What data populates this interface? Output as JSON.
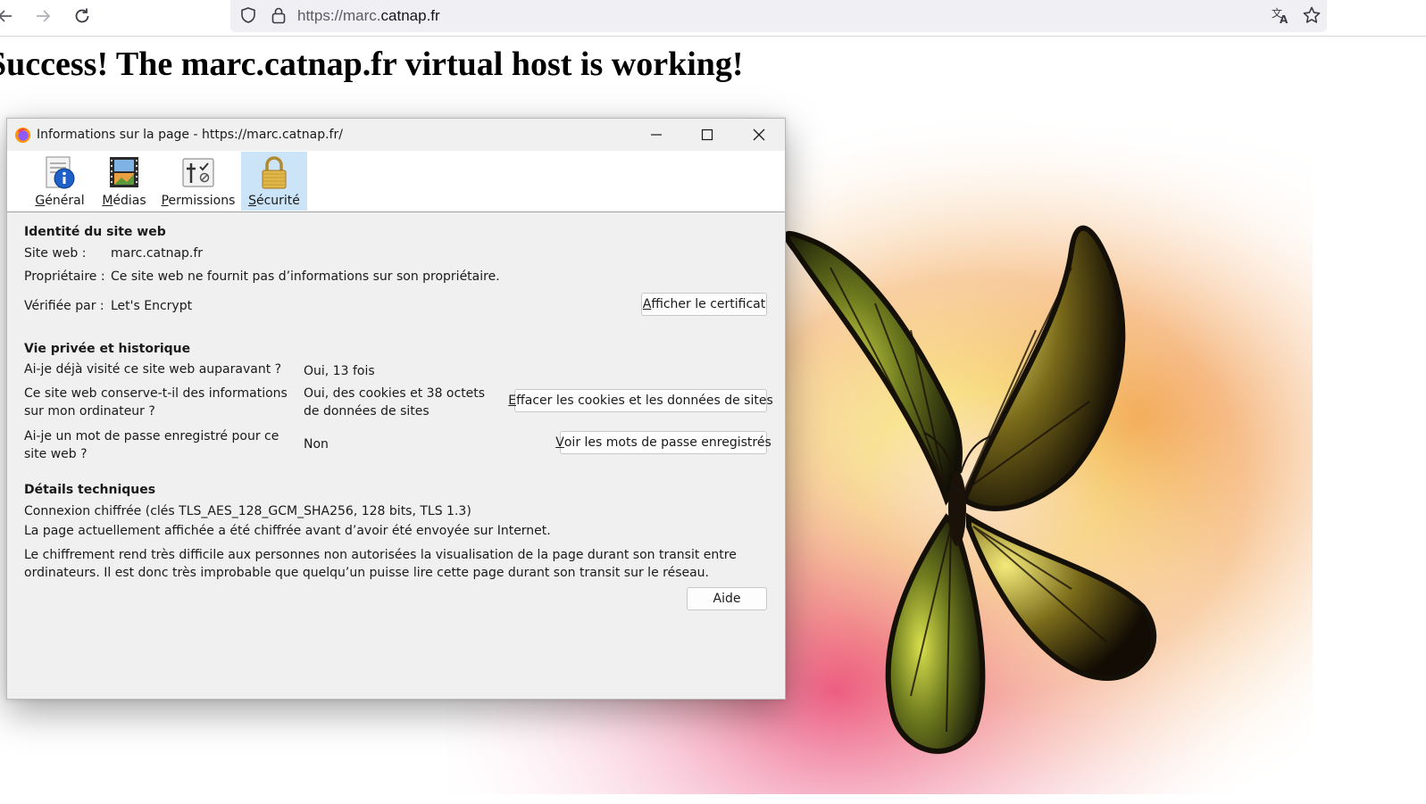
{
  "browser": {
    "url_prefix": "https://marc.",
    "url_domain": "catnap.fr"
  },
  "page": {
    "heading": "Success! The marc.catnap.fr virtual host is working!"
  },
  "dialog": {
    "title": "Informations sur la page - https://marc.catnap.fr/",
    "tabs": [
      {
        "underline": "G",
        "rest": "énéral",
        "icon": "info-icon"
      },
      {
        "underline": "M",
        "rest": "édias",
        "icon": "media-icon"
      },
      {
        "underline": "P",
        "rest": "ermissions",
        "icon": "permissions-icon"
      },
      {
        "underline": "S",
        "rest": "écurité",
        "icon": "lock-icon",
        "selected": true
      }
    ],
    "identity": {
      "heading": "Identité du site web",
      "website_label": "Site web :",
      "website_value": "marc.catnap.fr",
      "owner_label": "Propriétaire :",
      "owner_value": "Ce site web ne fournit pas d’informations sur son propriétaire.",
      "verified_label": "Vérifiée par :",
      "verified_value": "Let's Encrypt",
      "cert_button_u": "A",
      "cert_button_rest": "fficher le certificat"
    },
    "privacy": {
      "heading": "Vie privée et historique",
      "visited_q": "Ai-je déjà visité ce site web auparavant ?",
      "visited_a": "Oui, 13 fois",
      "storage_q": "Ce site web conserve-t-il des informations sur mon ordinateur ?",
      "storage_a": "Oui, des cookies et 38 octets de données de sites",
      "clear_button_u": "E",
      "clear_button_rest": "ffacer les cookies et les données de sites",
      "password_q": "Ai-je un mot de passe enregistré pour ce site web ?",
      "password_a": "Non",
      "passwords_button_u": "V",
      "passwords_button_rest": "oir les mots de passe enregistrés"
    },
    "technical": {
      "heading": "Détails techniques",
      "line1": "Connexion chiffrée (clés TLS_AES_128_GCM_SHA256, 128 bits, TLS 1.3)",
      "line2": "La page actuellement affichée a été chiffrée avant d’avoir été envoyée sur Internet.",
      "line3": "Le chiffrement rend très difficile aux personnes non autorisées la visualisation de la page durant son transit entre ordinateurs. Il est donc très improbable que quelqu’un puisse lire cette page durant son transit sur le réseau."
    },
    "help_button": "Aide"
  },
  "colors": {
    "selected_tab": "#cce4f7",
    "dialog_bg": "#f0f0f0",
    "url_bar": "#f0f0f4"
  }
}
